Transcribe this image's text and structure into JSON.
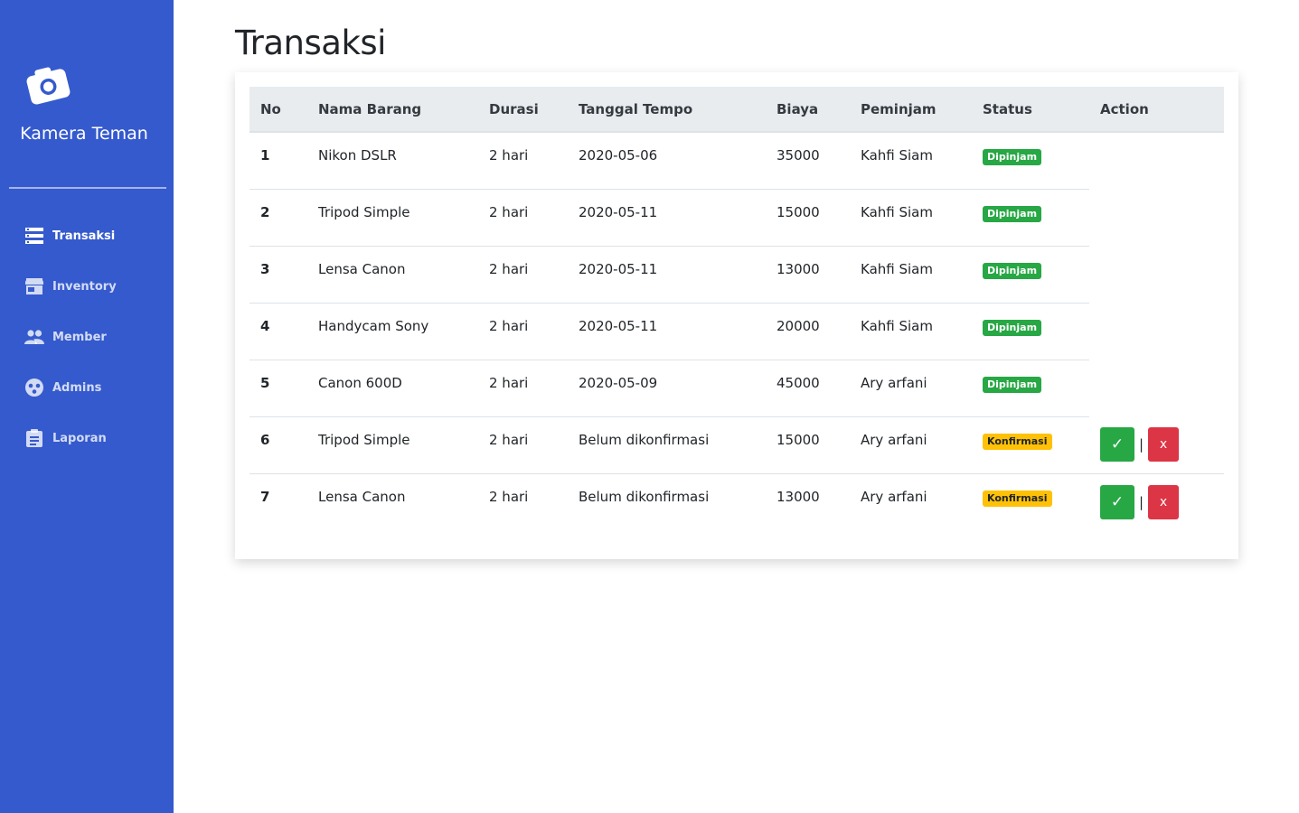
{
  "sidebar": {
    "brand": "Kamera Teman",
    "items": [
      {
        "label": "Transaksi",
        "icon": "list-icon",
        "active": true
      },
      {
        "label": "Inventory",
        "icon": "store-icon",
        "active": false
      },
      {
        "label": "Member",
        "icon": "people-icon",
        "active": false
      },
      {
        "label": "Admins",
        "icon": "admin-icon",
        "active": false
      },
      {
        "label": "Laporan",
        "icon": "clipboard-icon",
        "active": false
      }
    ]
  },
  "page": {
    "title": "Transaksi"
  },
  "table": {
    "headers": [
      "No",
      "Nama Barang",
      "Durasi",
      "Tanggal Tempo",
      "Biaya",
      "Peminjam",
      "Status",
      "Action"
    ],
    "rows": [
      {
        "no": "1",
        "nama": "Nikon DSLR",
        "durasi": "2 hari",
        "tempo": "2020-05-06",
        "biaya": "35000",
        "peminjam": "Kahfi Siam",
        "status": "Dipinjam"
      },
      {
        "no": "2",
        "nama": "Tripod Simple",
        "durasi": "2 hari",
        "tempo": "2020-05-11",
        "biaya": "15000",
        "peminjam": "Kahfi Siam",
        "status": "Dipinjam"
      },
      {
        "no": "3",
        "nama": "Lensa Canon",
        "durasi": "2 hari",
        "tempo": "2020-05-11",
        "biaya": "13000",
        "peminjam": "Kahfi Siam",
        "status": "Dipinjam"
      },
      {
        "no": "4",
        "nama": "Handycam Sony",
        "durasi": "2 hari",
        "tempo": "2020-05-11",
        "biaya": "20000",
        "peminjam": "Kahfi Siam",
        "status": "Dipinjam"
      },
      {
        "no": "5",
        "nama": "Canon 600D",
        "durasi": "2 hari",
        "tempo": "2020-05-09",
        "biaya": "45000",
        "peminjam": "Ary arfani",
        "status": "Dipinjam"
      },
      {
        "no": "6",
        "nama": "Tripod Simple",
        "durasi": "2 hari",
        "tempo": "Belum dikonfirmasi",
        "biaya": "15000",
        "peminjam": "Ary arfani",
        "status": "Konfirmasi"
      },
      {
        "no": "7",
        "nama": "Lensa Canon",
        "durasi": "2 hari",
        "tempo": "Belum dikonfirmasi",
        "biaya": "13000",
        "peminjam": "Ary arfani",
        "status": "Konfirmasi"
      }
    ],
    "actions": {
      "approve": "✓",
      "separator": "|",
      "reject": "x"
    }
  },
  "colors": {
    "sidebar": "#355acd",
    "success": "#28a745",
    "warning": "#ffc107",
    "danger": "#dc3545",
    "table_head": "#e9ecef"
  }
}
